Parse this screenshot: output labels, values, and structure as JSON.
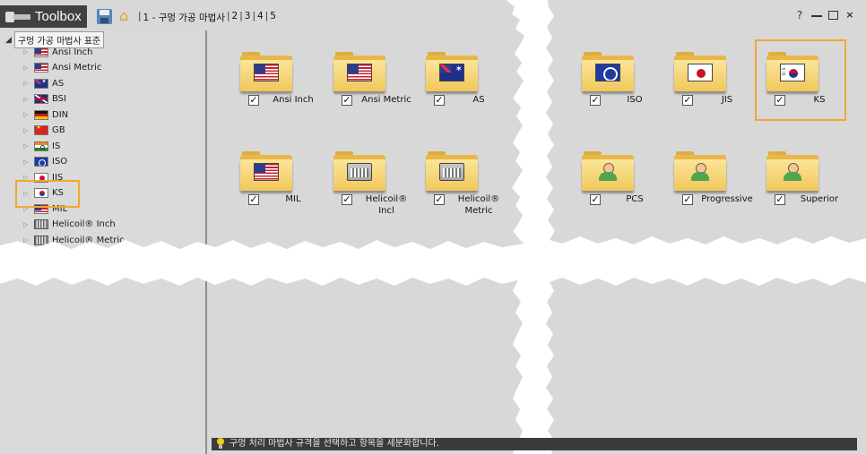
{
  "window": {
    "title": "Toolbox",
    "breadcrumb": [
      "1 - 구멍 가공 마법사",
      "2",
      "3",
      "4",
      "5"
    ],
    "controls": {
      "help": "?",
      "minimize": "",
      "maximize": "",
      "close": "×"
    }
  },
  "tree": {
    "root_label": "구멍 가공 마법사 표준",
    "items": [
      {
        "label": "Ansi Inch",
        "flag": "us"
      },
      {
        "label": "Ansi Metric",
        "flag": "us"
      },
      {
        "label": "AS",
        "flag": "au"
      },
      {
        "label": "BSI",
        "flag": "uk"
      },
      {
        "label": "DIN",
        "flag": "de"
      },
      {
        "label": "GB",
        "flag": "cn"
      },
      {
        "label": "IS",
        "flag": "in"
      },
      {
        "label": "ISO",
        "flag": "iso"
      },
      {
        "label": "JIS",
        "flag": "jp"
      },
      {
        "label": "KS",
        "flag": "kr",
        "highlighted": true
      },
      {
        "label": "MIL",
        "flag": "us"
      },
      {
        "label": "Helicoil® Inch",
        "flag": "heli"
      },
      {
        "label": "Helicoil® Metric",
        "flag": "heli"
      }
    ]
  },
  "tiles": {
    "row1_left": [
      {
        "label": "Ansi Inch",
        "emblem": "us",
        "checked": true
      },
      {
        "label": "Ansi Metric",
        "emblem": "us",
        "checked": true
      },
      {
        "label": "AS",
        "emblem": "au",
        "checked": true
      }
    ],
    "row2_left": [
      {
        "label": "MIL",
        "emblem": "us",
        "checked": true
      },
      {
        "label": "Helicoil® Incl",
        "emblem": "heli",
        "checked": true
      },
      {
        "label": "Helicoil® Metric",
        "emblem": "heli",
        "checked": true
      }
    ],
    "row1_right": [
      {
        "label": "ISO",
        "emblem": "iso",
        "checked": true
      },
      {
        "label": "JIS",
        "emblem": "jp",
        "checked": true
      },
      {
        "label": "KS",
        "emblem": "kr",
        "checked": true,
        "highlighted": true
      }
    ],
    "row2_right": [
      {
        "label": "PCS",
        "emblem": "person",
        "checked": true
      },
      {
        "label": "Progressive",
        "emblem": "person",
        "checked": true
      },
      {
        "label": "Superior",
        "emblem": "person",
        "checked": true
      }
    ],
    "check_glyph": "✓"
  },
  "status": {
    "message": "구멍 처리 마법사 규격을 선택하고 항목을 세분화합니다."
  },
  "colors": {
    "highlight": "#f0a830",
    "titlebar_dark": "#3f4142",
    "panel_bg": "#d8d8d8",
    "status_bg": "#3b3b3b"
  }
}
